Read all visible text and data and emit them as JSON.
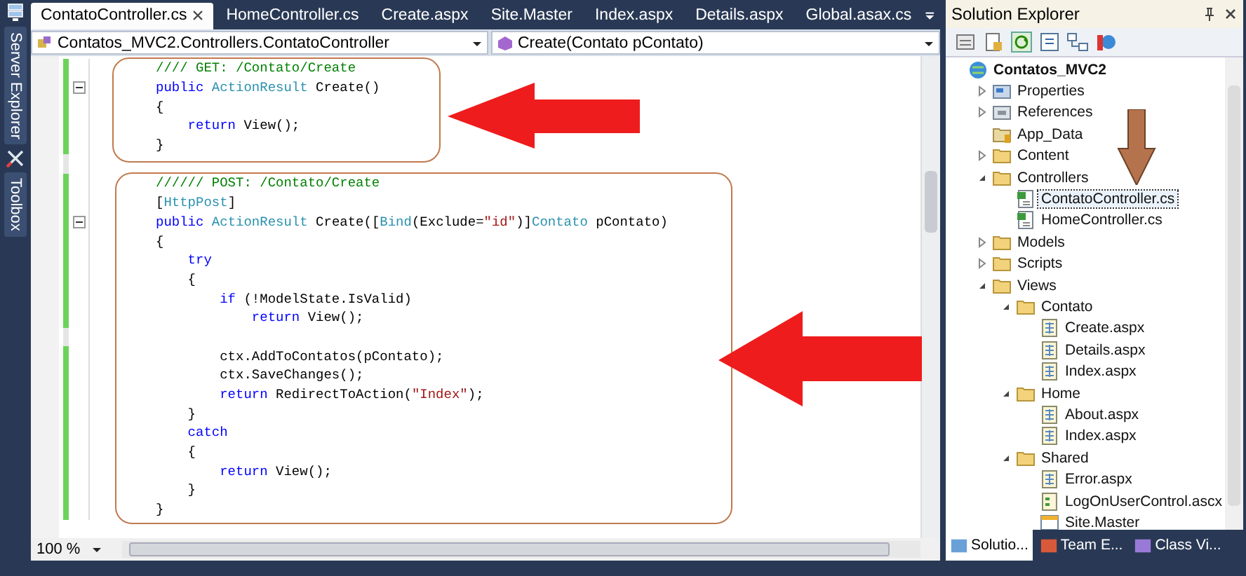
{
  "side_strip": {
    "tabs": [
      {
        "label": "Server Explorer"
      },
      {
        "label": "Toolbox"
      }
    ]
  },
  "editor": {
    "tabs": [
      {
        "label": "ContatoController.cs",
        "selected": true
      },
      {
        "label": "HomeController.cs",
        "selected": false
      },
      {
        "label": "Create.aspx",
        "selected": false
      },
      {
        "label": "Site.Master",
        "selected": false
      },
      {
        "label": "Index.aspx",
        "selected": false
      },
      {
        "label": "Details.aspx",
        "selected": false
      },
      {
        "label": "Global.asax.cs",
        "selected": false
      }
    ],
    "type_dropdown": "Contatos_MVC2.Controllers.ContatoController",
    "member_dropdown": "Create(Contato pContato)",
    "lines": [
      {
        "changed": true,
        "fold": false,
        "tokens": [
          {
            "t": "//// GET: /Contato/Create",
            "kind": "comment"
          }
        ]
      },
      {
        "changed": true,
        "fold": true,
        "tokens": [
          {
            "t": "public",
            "kind": "keyword"
          },
          {
            "t": " ActionResult",
            "kind": "type"
          },
          {
            "t": " Create()",
            "kind": "plain"
          }
        ]
      },
      {
        "changed": true,
        "fold": false,
        "tokens": [
          {
            "t": "{",
            "kind": "plain"
          }
        ]
      },
      {
        "changed": true,
        "fold": false,
        "tokens": [
          {
            "t": "    return",
            "kind": "keyword"
          },
          {
            "t": " View();",
            "kind": "plain"
          }
        ]
      },
      {
        "changed": true,
        "fold": false,
        "tokens": [
          {
            "t": "}",
            "kind": "plain"
          }
        ]
      },
      {
        "changed": false,
        "fold": false
      },
      {
        "changed": true,
        "fold": false,
        "tokens": [
          {
            "t": "////// POST: /Contato/Create",
            "kind": "comment"
          }
        ]
      },
      {
        "changed": true,
        "fold": false,
        "tokens": [
          {
            "t": "[",
            "kind": "plain"
          },
          {
            "t": "HttpPost",
            "kind": "type"
          },
          {
            "t": "]",
            "kind": "plain"
          }
        ]
      },
      {
        "changed": true,
        "fold": true,
        "tokens": [
          {
            "t": "public",
            "kind": "keyword"
          },
          {
            "t": " ActionResult",
            "kind": "type"
          },
          {
            "t": " Create([",
            "kind": "plain"
          },
          {
            "t": "Bind",
            "kind": "type"
          },
          {
            "t": "(Exclude=",
            "kind": "plain"
          },
          {
            "t": "\"id\"",
            "kind": "string"
          },
          {
            "t": ")]",
            "kind": "plain"
          },
          {
            "t": "Contato",
            "kind": "type"
          },
          {
            "t": " pContato)",
            "kind": "plain"
          }
        ]
      },
      {
        "changed": true,
        "fold": false,
        "tokens": [
          {
            "t": "{",
            "kind": "plain"
          }
        ]
      },
      {
        "changed": true,
        "fold": false,
        "tokens": [
          {
            "t": "    try",
            "kind": "keyword"
          }
        ]
      },
      {
        "changed": true,
        "fold": false,
        "tokens": [
          {
            "t": "    {",
            "kind": "plain"
          }
        ]
      },
      {
        "changed": true,
        "fold": false,
        "tokens": [
          {
            "t": "        if",
            "kind": "keyword"
          },
          {
            "t": " (!ModelState.IsValid)",
            "kind": "plain"
          }
        ]
      },
      {
        "changed": true,
        "fold": false,
        "tokens": [
          {
            "t": "            return",
            "kind": "keyword"
          },
          {
            "t": " View();",
            "kind": "plain"
          }
        ]
      },
      {
        "changed": false,
        "fold": false
      },
      {
        "changed": true,
        "fold": false,
        "tokens": [
          {
            "t": "        ctx.AddToContatos(pContato);",
            "kind": "plain"
          }
        ]
      },
      {
        "changed": true,
        "fold": false,
        "tokens": [
          {
            "t": "        ctx.SaveChanges();",
            "kind": "plain"
          }
        ]
      },
      {
        "changed": true,
        "fold": false,
        "tokens": [
          {
            "t": "        return",
            "kind": "keyword"
          },
          {
            "t": " RedirectToAction(",
            "kind": "plain"
          },
          {
            "t": "\"Index\"",
            "kind": "string"
          },
          {
            "t": ");",
            "kind": "plain"
          }
        ]
      },
      {
        "changed": true,
        "fold": false,
        "tokens": [
          {
            "t": "    }",
            "kind": "plain"
          }
        ]
      },
      {
        "changed": true,
        "fold": false,
        "tokens": [
          {
            "t": "    catch",
            "kind": "keyword"
          }
        ]
      },
      {
        "changed": true,
        "fold": false,
        "tokens": [
          {
            "t": "    {",
            "kind": "plain"
          }
        ]
      },
      {
        "changed": true,
        "fold": false,
        "tokens": [
          {
            "t": "        return",
            "kind": "keyword"
          },
          {
            "t": " View();",
            "kind": "plain"
          }
        ]
      },
      {
        "changed": true,
        "fold": false,
        "tokens": [
          {
            "t": "    }",
            "kind": "plain"
          }
        ]
      },
      {
        "changed": true,
        "fold": false,
        "tokens": [
          {
            "t": "}",
            "kind": "plain"
          }
        ]
      }
    ],
    "zoom": "100 %"
  },
  "solution_explorer": {
    "title": "Solution Explorer",
    "tree": [
      {
        "label": "Contatos_MVC2",
        "kind": "project",
        "selected": false,
        "children": [
          {
            "label": "Properties",
            "kind": "properties",
            "expanded": false,
            "selected": false
          },
          {
            "label": "References",
            "kind": "references",
            "expanded": false,
            "selected": false
          },
          {
            "label": "App_Data",
            "kind": "appdata",
            "selected": false
          },
          {
            "label": "Content",
            "kind": "folder",
            "expanded": false,
            "selected": false
          },
          {
            "label": "Controllers",
            "kind": "folder",
            "expanded": true,
            "selected": false,
            "children": [
              {
                "label": "ContatoController.cs",
                "kind": "cs",
                "selected": true
              },
              {
                "label": "HomeController.cs",
                "kind": "cs",
                "selected": false
              }
            ]
          },
          {
            "label": "Models",
            "kind": "folder",
            "expanded": false,
            "selected": false
          },
          {
            "label": "Scripts",
            "kind": "folder",
            "expanded": false,
            "selected": false
          },
          {
            "label": "Views",
            "kind": "folder",
            "expanded": true,
            "selected": false,
            "children": [
              {
                "label": "Contato",
                "kind": "folder",
                "expanded": true,
                "selected": false,
                "children": [
                  {
                    "label": "Create.aspx",
                    "kind": "aspx",
                    "selected": false
                  },
                  {
                    "label": "Details.aspx",
                    "kind": "aspx",
                    "selected": false
                  },
                  {
                    "label": "Index.aspx",
                    "kind": "aspx",
                    "selected": false
                  }
                ]
              },
              {
                "label": "Home",
                "kind": "folder",
                "expanded": true,
                "selected": false,
                "children": [
                  {
                    "label": "About.aspx",
                    "kind": "aspx",
                    "selected": false
                  },
                  {
                    "label": "Index.aspx",
                    "kind": "aspx",
                    "selected": false
                  }
                ]
              },
              {
                "label": "Shared",
                "kind": "folder",
                "expanded": true,
                "selected": false,
                "children": [
                  {
                    "label": "Error.aspx",
                    "kind": "aspx",
                    "selected": false
                  },
                  {
                    "label": "LogOnUserControl.ascx",
                    "kind": "ascx",
                    "selected": false
                  },
                  {
                    "label": "Site.Master",
                    "kind": "master",
                    "selected": false
                  }
                ]
              }
            ]
          }
        ]
      }
    ],
    "bottom_tabs": [
      {
        "label": "Solutio...",
        "selected": true
      },
      {
        "label": "Team E...",
        "selected": false
      },
      {
        "label": "Class Vi...",
        "selected": false
      }
    ]
  }
}
